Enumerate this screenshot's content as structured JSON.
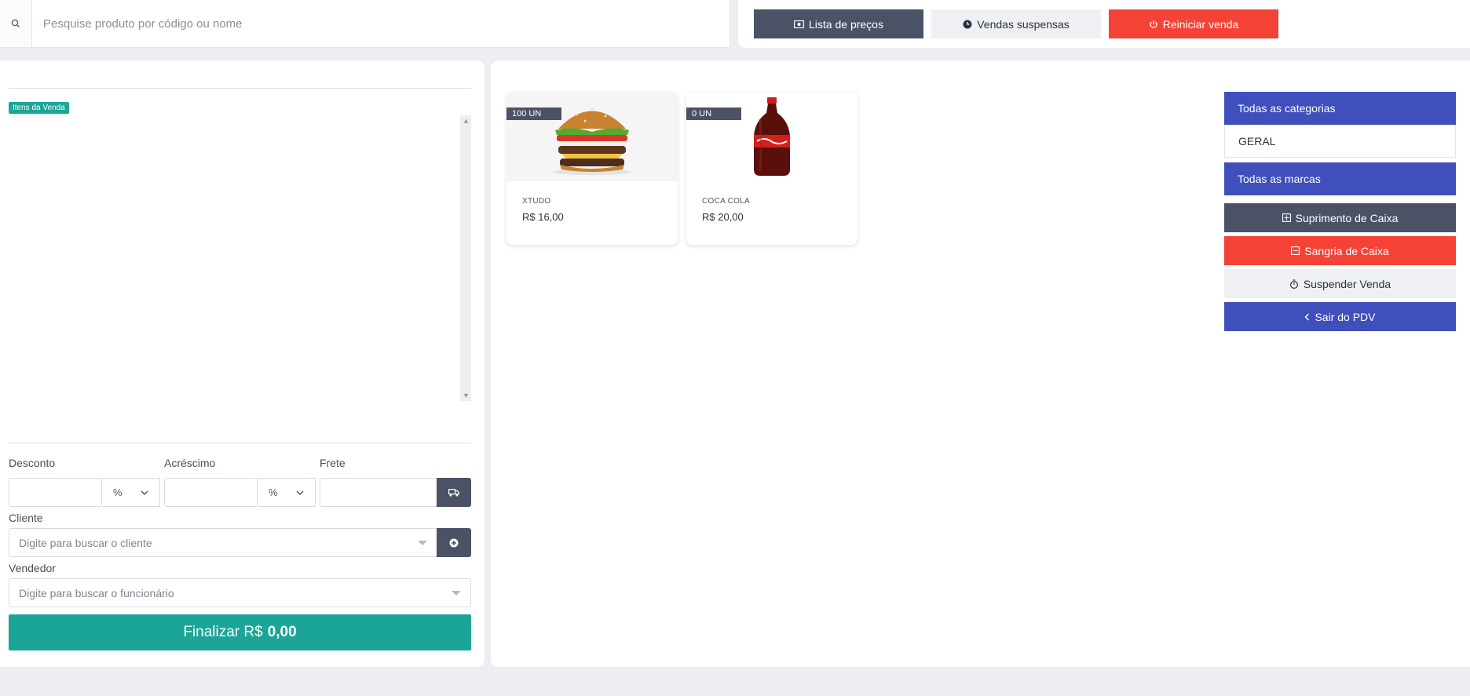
{
  "search": {
    "placeholder": "Pesquise produto por código ou nome"
  },
  "top_actions": {
    "price_list": "Lista de preços",
    "suspended_sales": "Vendas suspensas",
    "restart_sale": "Reiniciar venda"
  },
  "sale": {
    "items_badge": "Itens da Venda",
    "discount_label": "Desconto",
    "discount_unit": "%",
    "surcharge_label": "Acréscimo",
    "surcharge_unit": "%",
    "freight_label": "Frete",
    "client_label": "Cliente",
    "client_placeholder": "Digite para buscar o cliente",
    "seller_label": "Vendedor",
    "seller_placeholder": "Digite para buscar o funcionário",
    "finalize_label": "Finalizar R$",
    "finalize_total": "0,00"
  },
  "products": [
    {
      "name": "XTUDO",
      "price": "R$ 16,00",
      "stock": "100 UN"
    },
    {
      "name": "COCA COLA",
      "price": "R$ 20,00",
      "stock": "0 UN"
    }
  ],
  "sidebar": {
    "all_categories": "Todas as categorias",
    "category_general": "GERAL",
    "all_brands": "Todas as marcas",
    "cash_supply": "Suprimento de Caixa",
    "cash_withdrawal": "Sangria de Caixa",
    "suspend_sale": "Suspender Venda",
    "exit_pdv": "Sair do PDV"
  },
  "colors": {
    "accent_teal": "#1aa597",
    "dark": "#4c5266",
    "red": "#f44336",
    "blue": "#3f4fbb"
  }
}
